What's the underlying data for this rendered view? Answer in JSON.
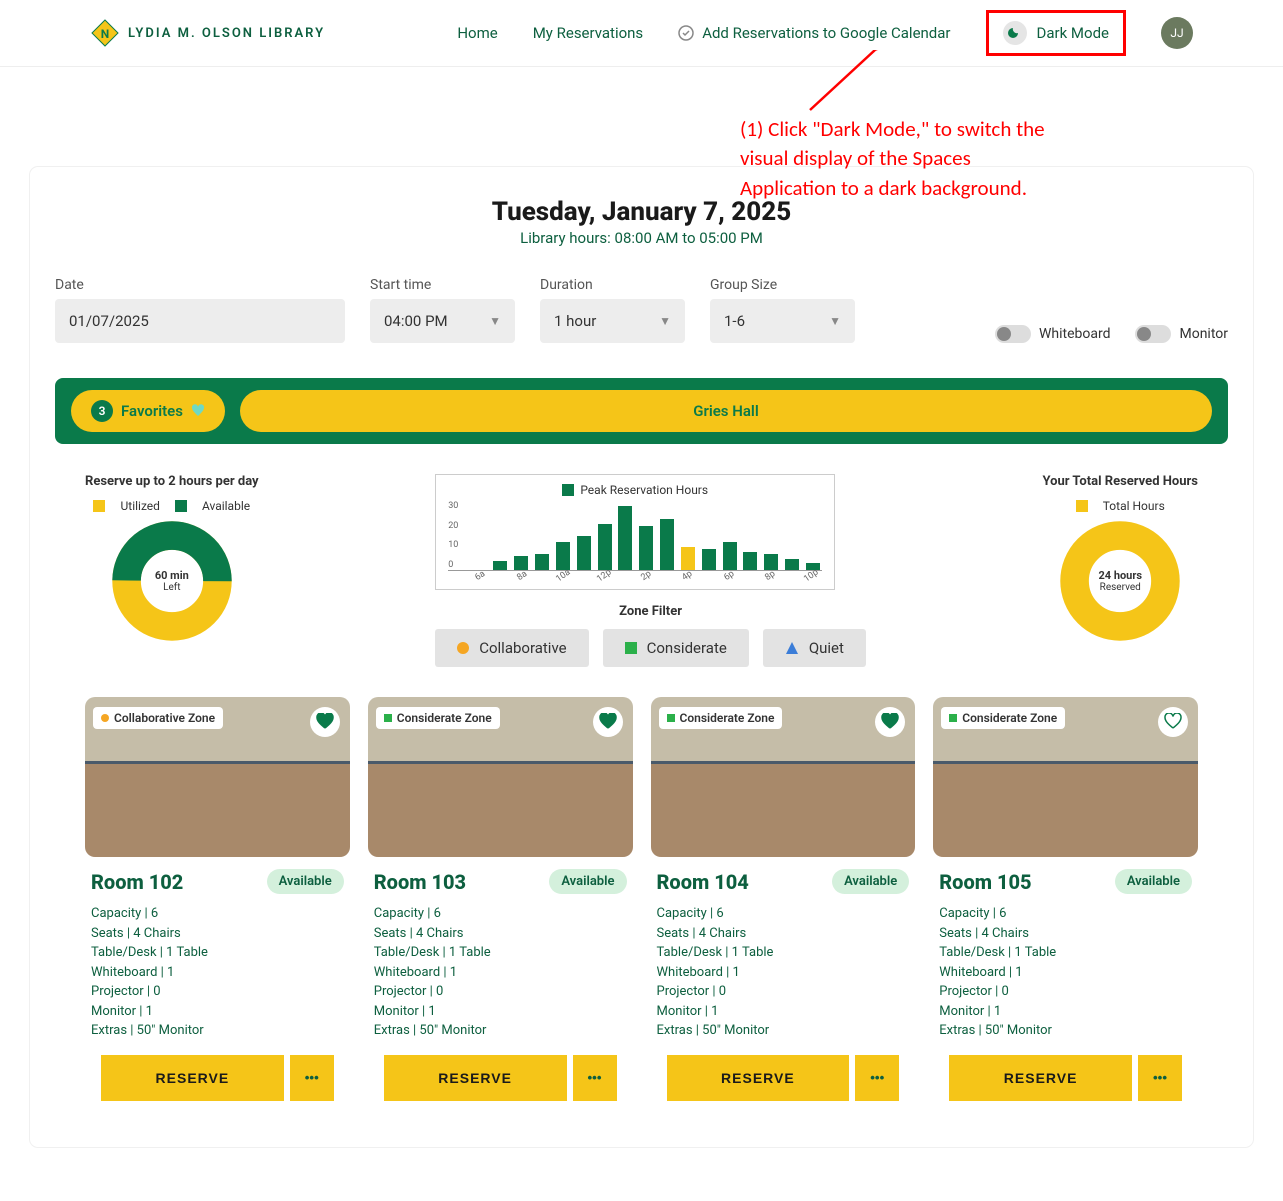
{
  "header": {
    "library_name": "LYDIA M. OLSON LIBRARY",
    "nav": {
      "home": "Home",
      "reservations": "My Reservations",
      "gcal": "Add Reservations to Google Calendar",
      "dark_mode": "Dark Mode"
    },
    "avatar": "JJ"
  },
  "annotation": "(1) Click \"Dark Mode,\" to switch the visual display of the Spaces Application to a dark background.",
  "date_header": {
    "title": "Tuesday, January 7, 2025",
    "hours": "Library hours: 08:00 AM to 05:00 PM"
  },
  "filters": {
    "date_label": "Date",
    "date_value": "01/07/2025",
    "start_label": "Start time",
    "start_value": "04:00 PM",
    "duration_label": "Duration",
    "duration_value": "1 hour",
    "size_label": "Group Size",
    "size_value": "1-6",
    "whiteboard": "Whiteboard",
    "monitor": "Monitor"
  },
  "tabs": {
    "fav_count": "3",
    "fav_label": "Favorites",
    "hall": "Gries Hall"
  },
  "stats": {
    "reserve_title": "Reserve up to 2 hours per day",
    "utilized": "Utilized",
    "available": "Available",
    "left_value": "60 min",
    "left_label": "Left",
    "peak_title": "Peak Reservation Hours",
    "zone_filter": "Zone Filter",
    "collaborative": "Collaborative",
    "considerate": "Considerate",
    "quiet": "Quiet",
    "total_title": "Your Total Reserved Hours",
    "total_legend": "Total Hours",
    "reserved_value": "24 hours",
    "reserved_label": "Reserved"
  },
  "chart_data": {
    "type": "bar",
    "title": "Peak Reservation Hours",
    "categories": [
      "6a",
      "",
      "8a",
      "",
      "10a",
      "",
      "12p",
      "",
      "2p",
      "",
      "4p",
      "",
      "6p",
      "",
      "8p",
      "",
      "10p"
    ],
    "values": [
      0,
      4,
      6,
      7,
      12,
      15,
      20,
      28,
      19,
      22,
      10,
      9,
      12,
      8,
      7,
      5,
      3
    ],
    "highlight_index": 10,
    "ylim": [
      0,
      30
    ],
    "yticks": [
      0,
      10,
      20,
      30
    ],
    "ylabel": "",
    "xlabel": ""
  },
  "rooms": [
    {
      "zone": "Collaborative Zone",
      "zone_color": "#f5a623",
      "name": "Room 102",
      "status": "Available",
      "heart_fill": true,
      "details": [
        "Capacity | 6",
        "Seats | 4 Chairs",
        "Table/Desk | 1 Table",
        "Whiteboard | 1",
        "Projector | 0",
        "Monitor | 1",
        "Extras | 50\" Monitor"
      ]
    },
    {
      "zone": "Considerate Zone",
      "zone_color": "#2bb04a",
      "name": "Room 103",
      "status": "Available",
      "heart_fill": true,
      "details": [
        "Capacity | 6",
        "Seats | 4 Chairs",
        "Table/Desk | 1 Table",
        "Whiteboard | 1",
        "Projector | 0",
        "Monitor | 1",
        "Extras | 50\" Monitor"
      ]
    },
    {
      "zone": "Considerate Zone",
      "zone_color": "#2bb04a",
      "name": "Room 104",
      "status": "Available",
      "heart_fill": true,
      "details": [
        "Capacity | 6",
        "Seats | 4 Chairs",
        "Table/Desk | 1 Table",
        "Whiteboard | 1",
        "Projector | 0",
        "Monitor | 1",
        "Extras | 50\" Monitor"
      ]
    },
    {
      "zone": "Considerate Zone",
      "zone_color": "#2bb04a",
      "name": "Room 105",
      "status": "Available",
      "heart_fill": false,
      "details": [
        "Capacity | 6",
        "Seats | 4 Chairs",
        "Table/Desk | 1 Table",
        "Whiteboard | 1",
        "Projector | 0",
        "Monitor | 1",
        "Extras | 50\" Monitor"
      ]
    }
  ],
  "reserve_label": "RESERVE"
}
